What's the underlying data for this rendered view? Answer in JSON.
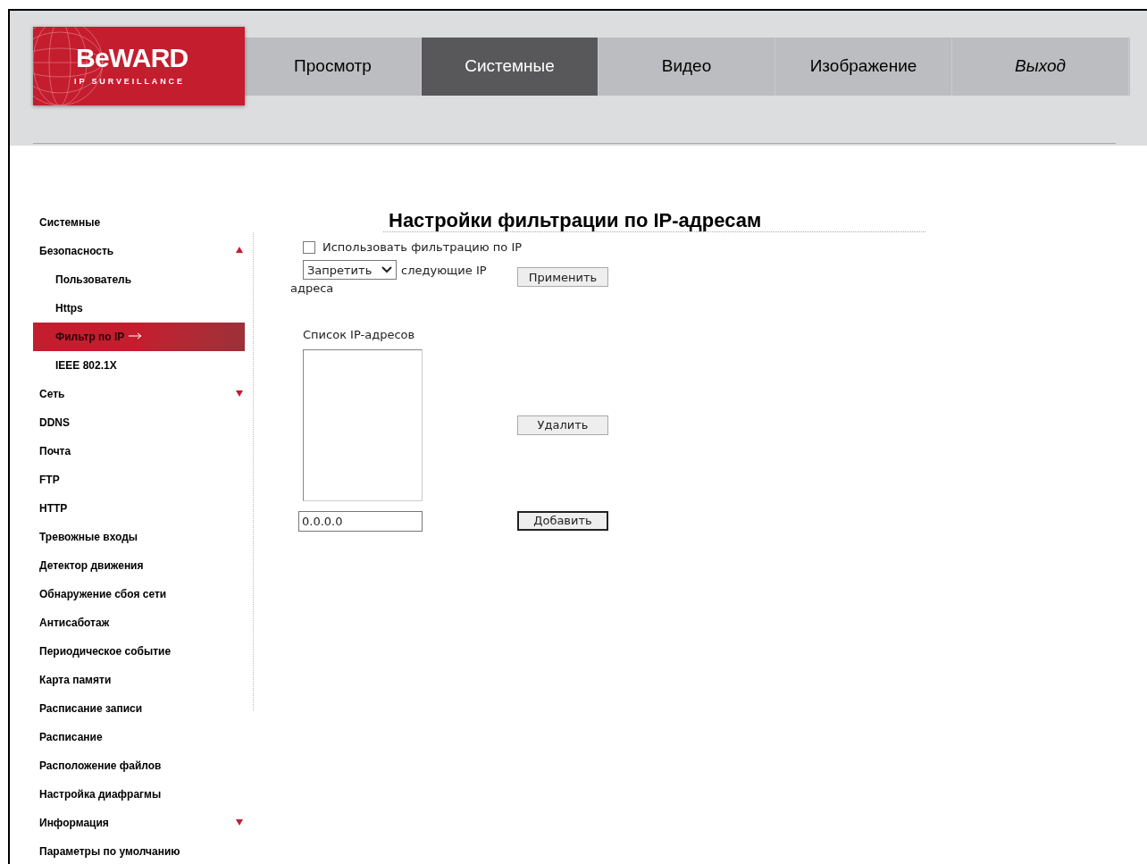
{
  "logo": {
    "name": "BeWARD",
    "tagline": "IP SURVEILLANCE"
  },
  "nav": [
    {
      "label": "Просмотр",
      "selected": false,
      "kind": "tab"
    },
    {
      "label": "Системные",
      "selected": true,
      "kind": "tab"
    },
    {
      "label": "Видео",
      "selected": false,
      "kind": "tab"
    },
    {
      "label": "Изображение",
      "selected": false,
      "kind": "tab"
    },
    {
      "label": "Выход",
      "selected": false,
      "kind": "exit"
    }
  ],
  "sidebar": {
    "items": [
      {
        "label": "Системные",
        "selected": false
      },
      {
        "label": "Безопасность",
        "selected": false,
        "expanded": true,
        "children": [
          {
            "label": "Пользователь",
            "selected": false
          },
          {
            "label": "Https",
            "selected": false
          },
          {
            "label": "Фильтр по IP",
            "selected": true
          },
          {
            "label": "IEEE 802.1X",
            "selected": false
          }
        ]
      },
      {
        "label": "Сеть",
        "selected": false,
        "expanded": false
      },
      {
        "label": "DDNS",
        "selected": false
      },
      {
        "label": "Почта",
        "selected": false
      },
      {
        "label": "FTP",
        "selected": false
      },
      {
        "label": "HTTP",
        "selected": false
      },
      {
        "label": "Тревожные входы",
        "selected": false
      },
      {
        "label": "Детектор движения",
        "selected": false
      },
      {
        "label": "Обнаружение сбоя сети",
        "selected": false
      },
      {
        "label": "Антисаботаж",
        "selected": false
      },
      {
        "label": "Периодическое событие",
        "selected": false
      },
      {
        "label": "Карта памяти",
        "selected": false
      },
      {
        "label": "Расписание записи",
        "selected": false
      },
      {
        "label": "Расписание",
        "selected": false
      },
      {
        "label": "Расположение файлов",
        "selected": false
      },
      {
        "label": "Настройка диафрагмы",
        "selected": false
      },
      {
        "label": "Информация",
        "selected": false,
        "expanded": false
      },
      {
        "label": "Параметры по умолчанию",
        "selected": false
      }
    ]
  },
  "main": {
    "title": "Настройки фильтрации по IP-адресам",
    "use_filter": {
      "label": "Использовать фильтрацию по IP",
      "checked": false
    },
    "mode": {
      "value": "Запретить",
      "text": "следующие IP",
      "text_continued": "адреса"
    },
    "apply_button": {
      "label": "Применить",
      "focused": false
    },
    "list_label": "Список IP-адресов",
    "delete_button": {
      "label": "Удалить",
      "focused": false
    },
    "ip_input": {
      "value": "0.0.0.0"
    },
    "add_button": {
      "label": "Добавить",
      "focused": true
    }
  }
}
